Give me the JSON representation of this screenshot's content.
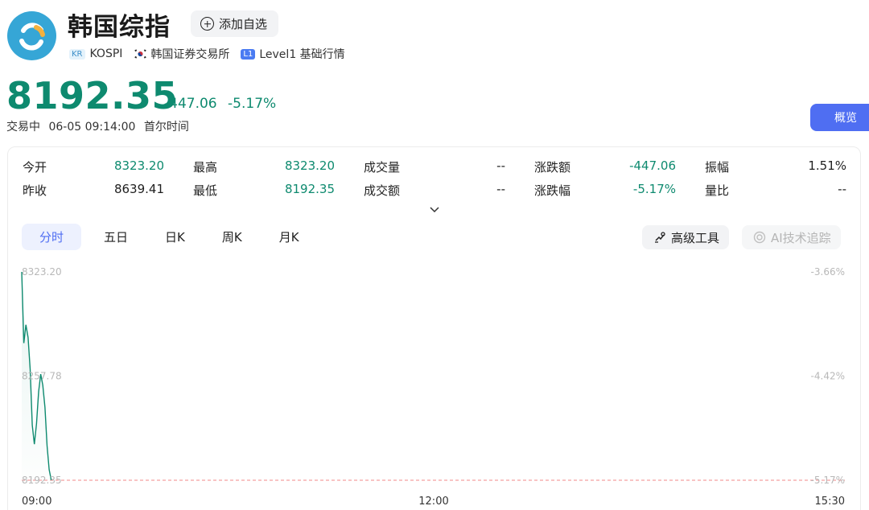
{
  "header": {
    "title": "韩国综指",
    "watch_label": "添加自选",
    "tags": {
      "region_code": "KR",
      "symbol": "KOSPI",
      "exchange": "韩国证券交易所",
      "level_badge": "L1",
      "level_label": "Level1 基础行情"
    }
  },
  "quote": {
    "price": "8192.35",
    "change": "-447.06",
    "change_pct": "-5.17%",
    "status": "交易中",
    "time": "06-05 09:14:00",
    "timezone": "首尔时间"
  },
  "overview_label": "概览",
  "stats": {
    "rows": [
      [
        {
          "label": "今开",
          "value": "8323.20",
          "tone": "green"
        },
        {
          "label": "最高",
          "value": "8323.20",
          "tone": "green"
        },
        {
          "label": "成交量",
          "value": "--",
          "tone": "dark"
        },
        {
          "label": "涨跌额",
          "value": "-447.06",
          "tone": "green"
        },
        {
          "label": "振幅",
          "value": "1.51%",
          "tone": "dark"
        }
      ],
      [
        {
          "label": "昨收",
          "value": "8639.41",
          "tone": "dark"
        },
        {
          "label": "最低",
          "value": "8192.35",
          "tone": "green"
        },
        {
          "label": "成交额",
          "value": "--",
          "tone": "dark"
        },
        {
          "label": "涨跌幅",
          "value": "-5.17%",
          "tone": "green"
        },
        {
          "label": "量比",
          "value": "--",
          "tone": "dark"
        }
      ]
    ]
  },
  "tabs": [
    "分时",
    "五日",
    "日K",
    "周K",
    "月K"
  ],
  "active_tab": "分时",
  "tools": {
    "advanced": "高级工具",
    "ai": "AI技术追踪"
  },
  "colors": {
    "price_down": "#0e8a6f",
    "accent": "#4f6ef2",
    "reference_line": "#f08a8a",
    "logo": "#36a6d6"
  },
  "chart_data": {
    "type": "line",
    "y_left_labels": [
      "8323.20",
      "8257.78",
      "8192.35"
    ],
    "y_right_labels": [
      "-3.66%",
      "-4.42%",
      "-5.17%"
    ],
    "x_labels": [
      "09:00",
      "12:00",
      "15:30"
    ],
    "ylim": [
      8192.35,
      8323.2
    ],
    "reference_value": 8192.35,
    "series": [
      {
        "x": [
          "09:00",
          "09:01",
          "09:02",
          "09:03",
          "09:04",
          "09:05",
          "09:06",
          "09:07",
          "09:08",
          "09:09",
          "09:10",
          "09:11",
          "09:12",
          "09:13",
          "09:14"
        ],
        "values": [
          8323.2,
          8278.5,
          8290.0,
          8282.0,
          8262.0,
          8227.0,
          8215.0,
          8228.0,
          8248.0,
          8259.0,
          8252.0,
          8238.0,
          8214.0,
          8199.0,
          8192.35
        ]
      }
    ]
  }
}
